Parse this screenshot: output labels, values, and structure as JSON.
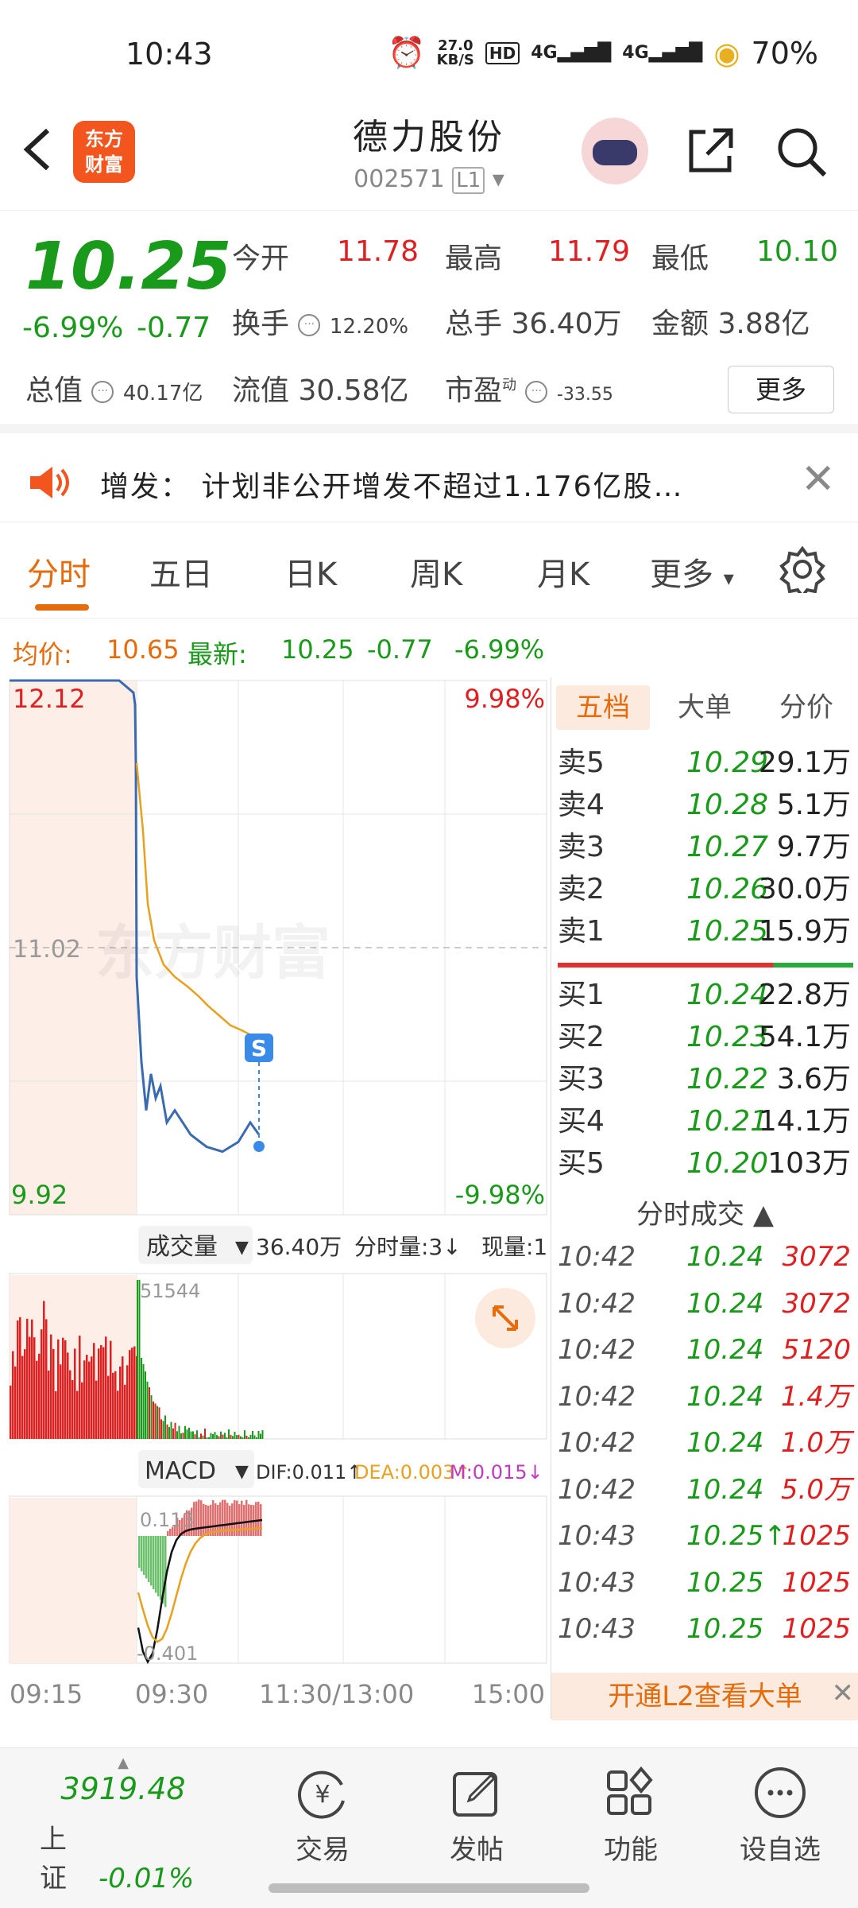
{
  "status_bar": {
    "time": "10:43",
    "speed_value": "27.0",
    "speed_unit": "KB/S",
    "hd": "HD",
    "net1": "4G",
    "net2": "4G",
    "battery": "70%"
  },
  "header": {
    "logo_line1": "东方",
    "logo_line2": "财富",
    "stock_name": "德力股份",
    "stock_code": "002571",
    "level": "L1"
  },
  "quote": {
    "price": "10.25",
    "change_pct": "-6.99%",
    "change": "-0.77",
    "open_label": "今开",
    "open": "11.78",
    "high_label": "最高",
    "high": "11.79",
    "low_label": "最低",
    "low": "10.10",
    "turnover_label": "换手",
    "turnover": "12.20%",
    "volume_label": "总手",
    "volume": "36.40万",
    "amount_label": "金额",
    "amount": "3.88亿",
    "mktcap_label": "总值",
    "mktcap": "40.17亿",
    "float_label": "流值",
    "float": "30.58亿",
    "pe_label": "市盈",
    "pe_sup": "动",
    "pe": "-33.55",
    "more": "更多"
  },
  "notice": {
    "text": "增发：  计划非公开增发不超过1.176亿股…"
  },
  "tabs": [
    "分时",
    "五日",
    "日K",
    "周K",
    "月K",
    "更多"
  ],
  "avg_line": {
    "avg_label": "均价:",
    "avg": "10.65",
    "latest_label": "最新:",
    "latest": "10.25",
    "change": "-0.77",
    "pct": "-6.99%"
  },
  "chart_data": [
    {
      "type": "line",
      "title": "",
      "y_labels": {
        "top": "12.12",
        "mid": "11.02",
        "bottom": "9.92",
        "top_pct": "9.98%",
        "bottom_pct": "-9.98%"
      },
      "ylim": [
        9.92,
        12.12
      ],
      "x_ticks": [
        "09:15",
        "09:30",
        "11:30/13:00",
        "15:00"
      ],
      "series": [
        {
          "values": [
            12.12,
            12.12,
            12.12,
            12.12,
            12.07,
            12.02,
            11.78,
            10.9,
            10.55,
            10.35,
            10.5,
            10.4,
            10.45,
            10.3,
            10.35,
            10.25,
            10.2,
            10.18,
            10.22,
            10.3,
            10.25
          ]
        },
        {
          "values": [
            11.78,
            11.5,
            11.2,
            11.05,
            10.95,
            10.9,
            10.86,
            10.82,
            10.78,
            10.74,
            10.7,
            10.68,
            10.66,
            10.65
          ]
        }
      ],
      "marker": "S",
      "watermark": "东方财富"
    },
    {
      "type": "bar",
      "title": "成交量",
      "total": "36.40万",
      "min_vol_label": "分时量:3↓",
      "now_label": "现量:1",
      "max_label": "51544"
    },
    {
      "type": "line",
      "title": "MACD",
      "dif": "DIF:0.011↑",
      "dea": "DEA:0.003↑",
      "m": "M:0.015↓",
      "top_label": "0.113",
      "bottom_label": "-0.401"
    }
  ],
  "orderbook": {
    "tabs": [
      "五档",
      "大单",
      "分价"
    ],
    "asks": [
      {
        "label": "卖5",
        "price": "10.29",
        "vol": "29.1万"
      },
      {
        "label": "卖4",
        "price": "10.28",
        "vol": "5.1万"
      },
      {
        "label": "卖3",
        "price": "10.27",
        "vol": "9.7万"
      },
      {
        "label": "卖2",
        "price": "10.26",
        "vol": "30.0万"
      },
      {
        "label": "卖1",
        "price": "10.25",
        "vol": "15.9万"
      }
    ],
    "bids": [
      {
        "label": "买1",
        "price": "10.24",
        "vol": "22.8万"
      },
      {
        "label": "买2",
        "price": "10.23",
        "vol": "54.1万"
      },
      {
        "label": "买3",
        "price": "10.22",
        "vol": "3.6万"
      },
      {
        "label": "买4",
        "price": "10.21",
        "vol": "14.1万"
      },
      {
        "label": "买5",
        "price": "10.20",
        "vol": "103万"
      }
    ],
    "trades_title": "分时成交",
    "trades": [
      {
        "time": "10:42",
        "price": "10.24",
        "vol": "3072"
      },
      {
        "time": "10:42",
        "price": "10.24",
        "vol": "3072"
      },
      {
        "time": "10:42",
        "price": "10.24",
        "vol": "5120"
      },
      {
        "time": "10:42",
        "price": "10.24",
        "vol": "1.4万"
      },
      {
        "time": "10:42",
        "price": "10.24",
        "vol": "1.0万"
      },
      {
        "time": "10:42",
        "price": "10.24",
        "vol": "5.0万"
      },
      {
        "time": "10:43",
        "price": "10.25↑",
        "vol": "1025"
      },
      {
        "time": "10:43",
        "price": "10.25",
        "vol": "1025"
      },
      {
        "time": "10:43",
        "price": "10.25",
        "vol": "1025"
      }
    ],
    "l2_banner": "开通L2查看大单"
  },
  "bottom_nav": {
    "index_value": "3919.48",
    "index_name": "上证",
    "index_change": "-0.01%",
    "items": [
      "交易",
      "发帖",
      "功能",
      "设自选"
    ]
  },
  "colors": {
    "up": "#e02020",
    "down": "#1a9a1a",
    "accent": "#e56b0b",
    "price_line": "#3a6ab0",
    "avg_line": "#e8a020"
  }
}
